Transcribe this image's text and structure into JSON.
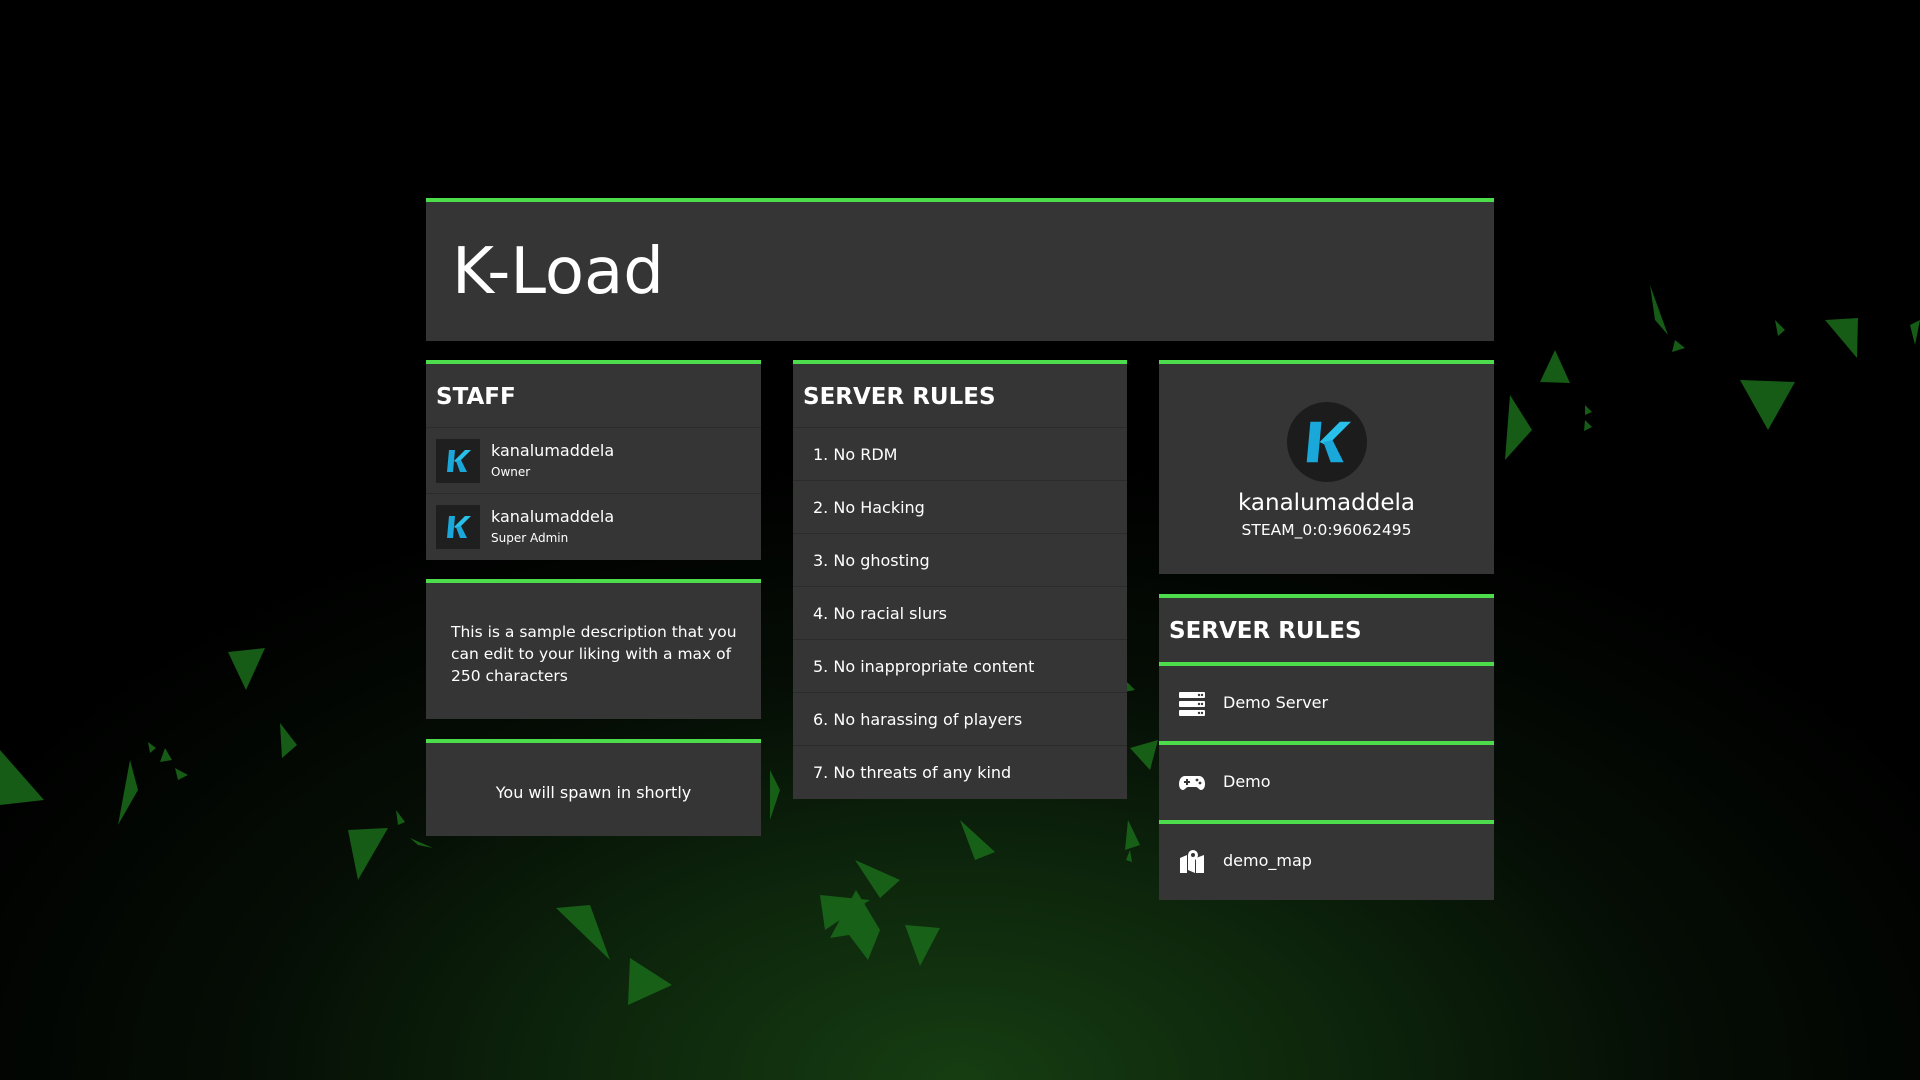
{
  "header": {
    "title": "K-Load"
  },
  "staff": {
    "title": "STAFF",
    "members": [
      {
        "name": "kanalumaddela",
        "role": "Owner"
      },
      {
        "name": "kanalumaddela",
        "role": "Super Admin"
      }
    ]
  },
  "description": {
    "text": "This is a sample description that you can edit to your liking with a max of 250 characters"
  },
  "spawn": {
    "text": "You will spawn in shortly"
  },
  "rules": {
    "title": "SERVER RULES",
    "items": [
      "1. No RDM",
      "2. No Hacking",
      "3. No ghosting",
      "4. No racial slurs",
      "5. No inappropriate content",
      "6. No harassing of players",
      "7. No threats of any kind"
    ]
  },
  "profile": {
    "name": "kanalumaddela",
    "steamid": "STEAM_0:0:96062495"
  },
  "server_info": {
    "title": "SERVER RULES",
    "rows": [
      {
        "icon": "server-icon",
        "label": "Demo Server"
      },
      {
        "icon": "gamepad-icon",
        "label": "Demo"
      },
      {
        "icon": "map-icon",
        "label": "demo_map"
      }
    ]
  },
  "colors": {
    "accent": "#4cdc4c",
    "panel": "#353535",
    "logo_k": "#1aa7d9"
  }
}
